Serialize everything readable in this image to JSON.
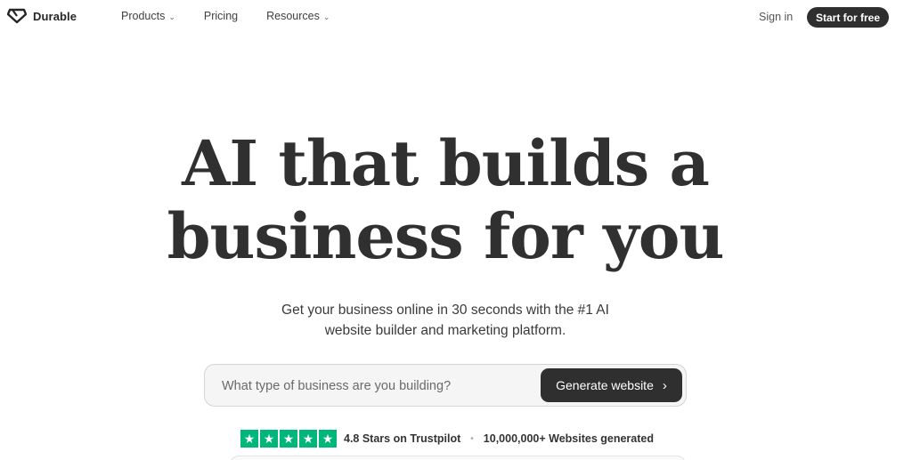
{
  "nav": {
    "logo_text": "Durable",
    "links": [
      {
        "label": "Products",
        "has_dropdown": true
      },
      {
        "label": "Pricing",
        "has_dropdown": false
      },
      {
        "label": "Resources",
        "has_dropdown": true
      }
    ],
    "signin_label": "Sign in",
    "start_label": "Start for free"
  },
  "hero": {
    "title_line1": "AI that builds a",
    "title_line2": "business for you",
    "subtitle_line1": "Get your business online in 30 seconds with the #1 AI",
    "subtitle_line2": "website builder and marketing platform."
  },
  "search": {
    "placeholder": "What type of business are you building?",
    "value": "",
    "button_label": "Generate website",
    "button_icon": "chevron-right-icon"
  },
  "trust": {
    "stars": 5,
    "rating_label": "4.8 Stars on Trustpilot",
    "separator": "•",
    "count_label": "10,000,000+ Websites generated"
  },
  "colors": {
    "accent_dark": "#2f2f2f",
    "trustpilot_green": "#00b67a"
  }
}
